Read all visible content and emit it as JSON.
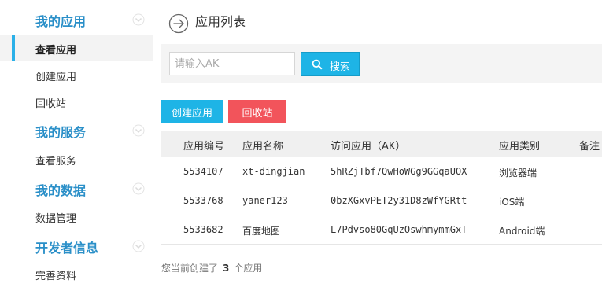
{
  "sidebar": {
    "groups": [
      {
        "title": "我的应用",
        "items": [
          "查看应用",
          "创建应用",
          "回收站"
        ]
      },
      {
        "title": "我的服务",
        "items": [
          "查看服务"
        ]
      },
      {
        "title": "我的数据",
        "items": [
          "数据管理"
        ]
      },
      {
        "title": "开发者信息",
        "items": [
          "完善资料"
        ]
      }
    ],
    "active_item": "查看应用"
  },
  "page": {
    "title": "应用列表"
  },
  "search": {
    "placeholder": "请输入AK",
    "value": "",
    "button_label": "搜索"
  },
  "actions": {
    "create_label": "创建应用",
    "recycle_label": "回收站"
  },
  "table": {
    "headers": [
      "应用编号",
      "应用名称",
      "访问应用（AK）",
      "应用类别",
      "备注"
    ],
    "rows": [
      {
        "id": "5534107",
        "name": "xt-dingjian",
        "ak": "5hRZjTbf7QwHoWGg9GGqaUOX",
        "type": "浏览器端"
      },
      {
        "id": "5533768",
        "name": "yaner123",
        "ak": "0bzXGxvPET2y31D8zWfYGRtt",
        "type": "iOS端"
      },
      {
        "id": "5533682",
        "name": "百度地图",
        "ak": "L7Pdvso80GqUzOswhmymmGxT",
        "type": "Android端"
      }
    ]
  },
  "footer": {
    "prefix": "您当前创建了",
    "count": "3",
    "suffix": "个应用"
  },
  "colors": {
    "accent": "#1eb4e6",
    "danger": "#f2545b",
    "group_title": "#2a8fc8"
  }
}
